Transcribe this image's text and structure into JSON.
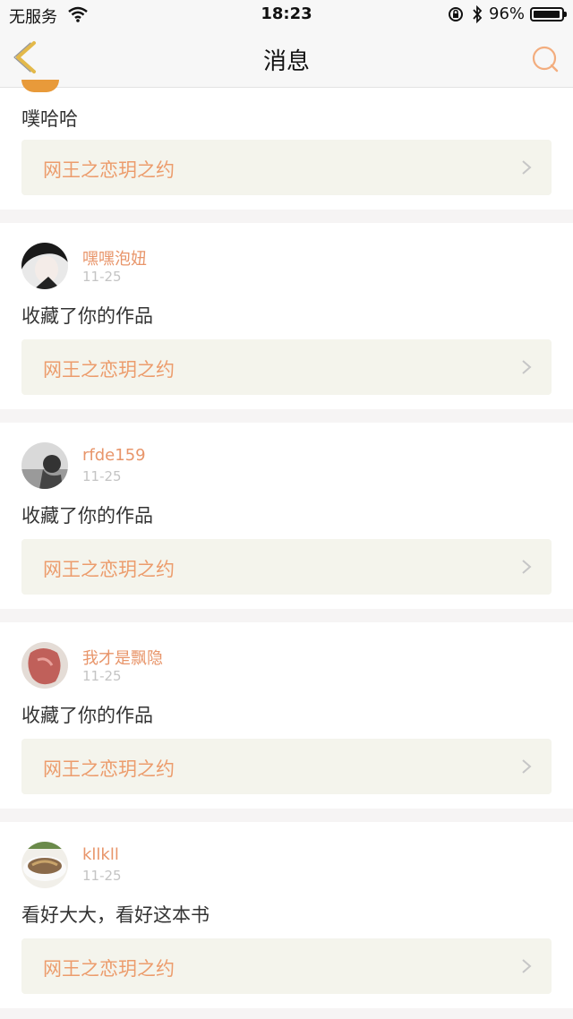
{
  "status_bar": {
    "carrier": "无服务",
    "time": "18:23",
    "battery_percent": "96%",
    "battery_level": 0.96
  },
  "nav": {
    "title": "消息",
    "back_icon": "chevron-left-icon",
    "search_icon": "search-icon"
  },
  "colors": {
    "accent": "#e8956a",
    "nav_icon": "#e3b94a",
    "link_bg": "#f4f4ec"
  },
  "messages": [
    {
      "username": "",
      "date": "",
      "text": "噗哈哈",
      "work": "网王之恋玥之约"
    },
    {
      "username": "嘿嘿泡妞",
      "date": "11-25",
      "text": "收藏了你的作品",
      "work": "网王之恋玥之约"
    },
    {
      "username": "rfde159",
      "date": "11-25",
      "text": "收藏了你的作品",
      "work": "网王之恋玥之约"
    },
    {
      "username": "我才是飘隐",
      "date": "11-25",
      "text": "收藏了你的作品",
      "work": "网王之恋玥之约"
    },
    {
      "username": "kllkll",
      "date": "11-25",
      "text": "看好大大，看好这本书",
      "work": "网王之恋玥之约"
    }
  ]
}
